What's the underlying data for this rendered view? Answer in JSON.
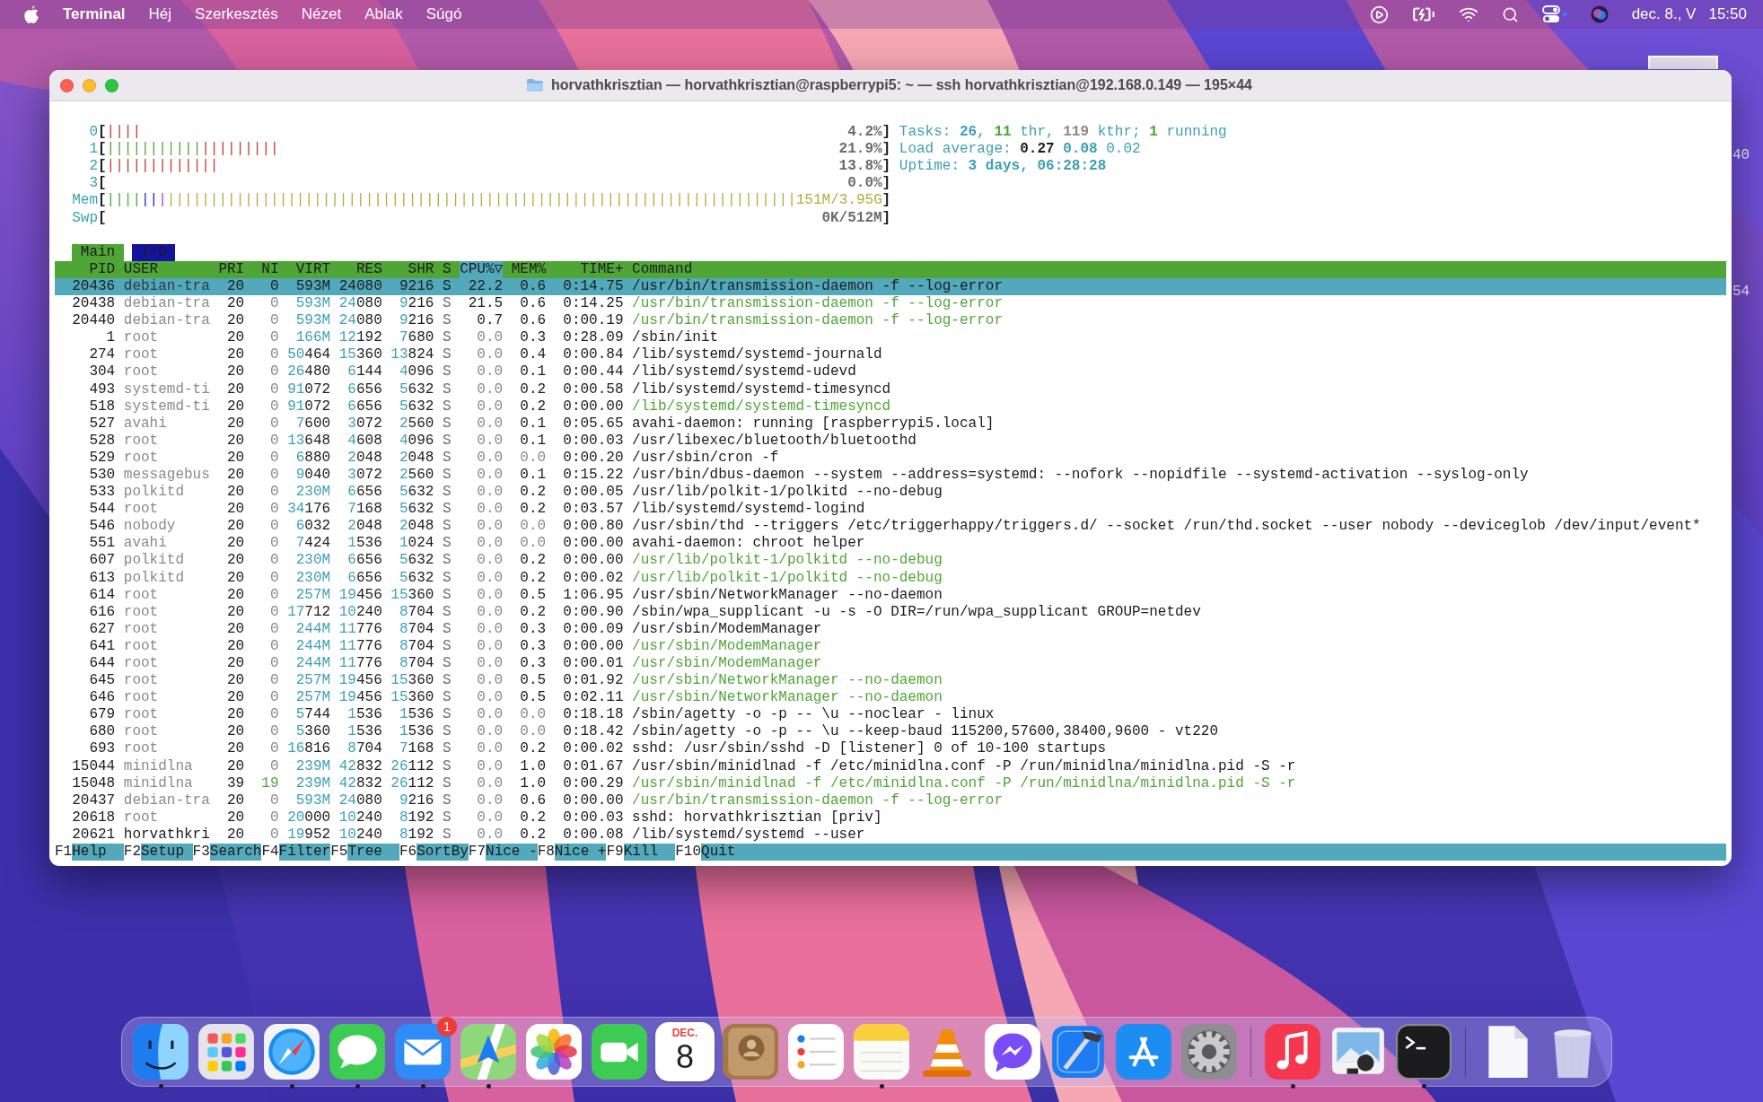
{
  "menu_bar": {
    "app_name": "Terminal",
    "menus": [
      "Héj",
      "Szerkesztés",
      "Nézet",
      "Ablak",
      "Súgó"
    ],
    "date": "dec. 8., V",
    "time": "15:50"
  },
  "window": {
    "title": "horvathkrisztian — horvathkrisztian@raspberrypi5: ~ — ssh horvathkrisztian@192.168.0.149 — 195×44"
  },
  "background_window": {
    "texts": [
      "40",
      "54"
    ]
  },
  "htop": {
    "brackets": [
      "[",
      "]"
    ],
    "meters": [
      {
        "label": "0",
        "segments": [
          {
            "text": "||||",
            "kind": "kernel"
          }
        ],
        "value": "4.2%"
      },
      {
        "label": "1",
        "segments": [
          {
            "text": "|||||||||||",
            "kind": "normal"
          },
          {
            "text": "|||||||||",
            "kind": "kernel"
          }
        ],
        "value": "21.9%"
      },
      {
        "label": "2",
        "segments": [
          {
            "text": "|||||||||||||",
            "kind": "kernel"
          }
        ],
        "value": "13.8%"
      },
      {
        "label": "3",
        "value": "0.0%"
      },
      {
        "label": "Mem",
        "segments": [
          {
            "text": "||||",
            "kind": "normal"
          },
          {
            "text": "||",
            "kind": "buffers"
          },
          {
            "text": "|",
            "kind": "shared"
          },
          {
            "text": "|||||||||||||||||||||||||||||||||||||||||||||||||||||||||||||||||||||||||",
            "kind": "cache"
          }
        ],
        "value": "151M/3.95G",
        "value_in_bar": true
      },
      {
        "label": "Swp",
        "value": "0K/512M"
      }
    ],
    "readouts": [
      [
        {
          "text": "Tasks: ",
          "kind": "label"
        },
        {
          "text": "26",
          "kind": "value"
        },
        {
          "text": ", ",
          "kind": "label"
        },
        {
          "text": "11",
          "kind": "thread"
        },
        {
          "text": " thr, ",
          "kind": "label"
        },
        {
          "text": "119",
          "kind": "kthread"
        },
        {
          "text": " kthr; ",
          "kind": "label"
        },
        {
          "text": "1",
          "kind": "running"
        },
        {
          "text": " running",
          "kind": "label"
        }
      ],
      [
        {
          "text": "Load average: ",
          "kind": "label"
        },
        {
          "text": "0.27 ",
          "kind": "load1"
        },
        {
          "text": "0.08 ",
          "kind": "load5"
        },
        {
          "text": "0.02",
          "kind": "load15"
        }
      ],
      [
        {
          "text": "Uptime: ",
          "kind": "label"
        },
        {
          "text": "3 days, 06:28:28",
          "kind": "value"
        }
      ]
    ],
    "tabs": [
      {
        "label": "Main",
        "selected": true
      },
      {
        "label": "I/O",
        "selected": false
      }
    ],
    "columns": [
      {
        "label": "PID",
        "sorted": false
      },
      {
        "label": "USER",
        "sorted": false
      },
      {
        "label": "PRI",
        "sorted": false
      },
      {
        "label": "NI",
        "sorted": false
      },
      {
        "label": "VIRT",
        "sorted": false
      },
      {
        "label": "RES",
        "sorted": false
      },
      {
        "label": "SHR",
        "sorted": false
      },
      {
        "label": "S",
        "sorted": false
      },
      {
        "label": "CPU%▽",
        "sorted": true
      },
      {
        "label": "MEM%",
        "sorted": false
      },
      {
        "label": "TIME+",
        "sorted": false
      },
      {
        "label": "Command",
        "sorted": false
      }
    ],
    "rows": [
      {
        "pid": "20436",
        "user": "debian-tra",
        "user_dimmed": true,
        "pri": "20",
        "ni": "0",
        "virt": "593M",
        "res": "24080",
        "shr": "9216",
        "state": "S",
        "cpu": "22.2",
        "mem": "0.6",
        "time": "0:14.75",
        "command": "/usr/bin/transmission-daemon -f --log-error",
        "thread": false,
        "selected": true
      },
      {
        "pid": "20438",
        "user": "debian-tra",
        "user_dimmed": true,
        "pri": "20",
        "ni": "0",
        "virt": "593M",
        "res": "24080",
        "shr": "9216",
        "state": "S",
        "cpu": "21.5",
        "mem": "0.6",
        "time": "0:14.25",
        "command": "/usr/bin/transmission-daemon -f --log-error",
        "thread": true,
        "selected": false
      },
      {
        "pid": "20440",
        "user": "debian-tra",
        "user_dimmed": true,
        "pri": "20",
        "ni": "0",
        "virt": "593M",
        "res": "24080",
        "shr": "9216",
        "state": "S",
        "cpu": "0.7",
        "mem": "0.6",
        "time": "0:00.19",
        "command": "/usr/bin/transmission-daemon -f --log-error",
        "thread": true,
        "selected": false
      },
      {
        "pid": "1",
        "user": "root",
        "user_dimmed": true,
        "pri": "20",
        "ni": "0",
        "virt": "166M",
        "res": "12192",
        "shr": "7680",
        "state": "S",
        "cpu": "0.0",
        "mem": "0.3",
        "time": "0:28.09",
        "command": "/sbin/init",
        "thread": false,
        "selected": false
      },
      {
        "pid": "274",
        "user": "root",
        "user_dimmed": true,
        "pri": "20",
        "ni": "0",
        "virt": "50464",
        "res": "15360",
        "shr": "13824",
        "state": "S",
        "cpu": "0.0",
        "mem": "0.4",
        "time": "0:00.84",
        "command": "/lib/systemd/systemd-journald",
        "thread": false,
        "selected": false
      },
      {
        "pid": "304",
        "user": "root",
        "user_dimmed": true,
        "pri": "20",
        "ni": "0",
        "virt": "26480",
        "res": "6144",
        "shr": "4096",
        "state": "S",
        "cpu": "0.0",
        "mem": "0.1",
        "time": "0:00.44",
        "command": "/lib/systemd/systemd-udevd",
        "thread": false,
        "selected": false
      },
      {
        "pid": "493",
        "user": "systemd-ti",
        "user_dimmed": true,
        "pri": "20",
        "ni": "0",
        "virt": "91072",
        "res": "6656",
        "shr": "5632",
        "state": "S",
        "cpu": "0.0",
        "mem": "0.2",
        "time": "0:00.58",
        "command": "/lib/systemd/systemd-timesyncd",
        "thread": false,
        "selected": false
      },
      {
        "pid": "518",
        "user": "systemd-ti",
        "user_dimmed": true,
        "pri": "20",
        "ni": "0",
        "virt": "91072",
        "res": "6656",
        "shr": "5632",
        "state": "S",
        "cpu": "0.0",
        "mem": "0.2",
        "time": "0:00.00",
        "command": "/lib/systemd/systemd-timesyncd",
        "thread": true,
        "selected": false
      },
      {
        "pid": "527",
        "user": "avahi",
        "user_dimmed": true,
        "pri": "20",
        "ni": "0",
        "virt": "7600",
        "res": "3072",
        "shr": "2560",
        "state": "S",
        "cpu": "0.0",
        "mem": "0.1",
        "time": "0:05.65",
        "command": "avahi-daemon: running [raspberrypi5.local]",
        "thread": false,
        "selected": false
      },
      {
        "pid": "528",
        "user": "root",
        "user_dimmed": true,
        "pri": "20",
        "ni": "0",
        "virt": "13648",
        "res": "4608",
        "shr": "4096",
        "state": "S",
        "cpu": "0.0",
        "mem": "0.1",
        "time": "0:00.03",
        "command": "/usr/libexec/bluetooth/bluetoothd",
        "thread": false,
        "selected": false
      },
      {
        "pid": "529",
        "user": "root",
        "user_dimmed": true,
        "pri": "20",
        "ni": "0",
        "virt": "6880",
        "res": "2048",
        "shr": "2048",
        "state": "S",
        "cpu": "0.0",
        "mem": "0.0",
        "time": "0:00.20",
        "command": "/usr/sbin/cron -f",
        "thread": false,
        "selected": false
      },
      {
        "pid": "530",
        "user": "messagebus",
        "user_dimmed": true,
        "pri": "20",
        "ni": "0",
        "virt": "9040",
        "res": "3072",
        "shr": "2560",
        "state": "S",
        "cpu": "0.0",
        "mem": "0.1",
        "time": "0:15.22",
        "command": "/usr/bin/dbus-daemon --system --address=systemd: --nofork --nopidfile --systemd-activation --syslog-only",
        "thread": false,
        "selected": false
      },
      {
        "pid": "533",
        "user": "polkitd",
        "user_dimmed": true,
        "pri": "20",
        "ni": "0",
        "virt": "230M",
        "res": "6656",
        "shr": "5632",
        "state": "S",
        "cpu": "0.0",
        "mem": "0.2",
        "time": "0:00.05",
        "command": "/usr/lib/polkit-1/polkitd --no-debug",
        "thread": false,
        "selected": false
      },
      {
        "pid": "544",
        "user": "root",
        "user_dimmed": true,
        "pri": "20",
        "ni": "0",
        "virt": "34176",
        "res": "7168",
        "shr": "5632",
        "state": "S",
        "cpu": "0.0",
        "mem": "0.2",
        "time": "0:03.57",
        "command": "/lib/systemd/systemd-logind",
        "thread": false,
        "selected": false
      },
      {
        "pid": "546",
        "user": "nobody",
        "user_dimmed": true,
        "pri": "20",
        "ni": "0",
        "virt": "6032",
        "res": "2048",
        "shr": "2048",
        "state": "S",
        "cpu": "0.0",
        "mem": "0.0",
        "time": "0:00.80",
        "command": "/usr/sbin/thd --triggers /etc/triggerhappy/triggers.d/ --socket /run/thd.socket --user nobody --deviceglob /dev/input/event*",
        "thread": false,
        "selected": false
      },
      {
        "pid": "551",
        "user": "avahi",
        "user_dimmed": true,
        "pri": "20",
        "ni": "0",
        "virt": "7424",
        "res": "1536",
        "shr": "1024",
        "state": "S",
        "cpu": "0.0",
        "mem": "0.0",
        "time": "0:00.00",
        "command": "avahi-daemon: chroot helper",
        "thread": false,
        "selected": false
      },
      {
        "pid": "607",
        "user": "polkitd",
        "user_dimmed": true,
        "pri": "20",
        "ni": "0",
        "virt": "230M",
        "res": "6656",
        "shr": "5632",
        "state": "S",
        "cpu": "0.0",
        "mem": "0.2",
        "time": "0:00.00",
        "command": "/usr/lib/polkit-1/polkitd --no-debug",
        "thread": true,
        "selected": false
      },
      {
        "pid": "613",
        "user": "polkitd",
        "user_dimmed": true,
        "pri": "20",
        "ni": "0",
        "virt": "230M",
        "res": "6656",
        "shr": "5632",
        "state": "S",
        "cpu": "0.0",
        "mem": "0.2",
        "time": "0:00.02",
        "command": "/usr/lib/polkit-1/polkitd --no-debug",
        "thread": true,
        "selected": false
      },
      {
        "pid": "614",
        "user": "root",
        "user_dimmed": true,
        "pri": "20",
        "ni": "0",
        "virt": "257M",
        "res": "19456",
        "shr": "15360",
        "state": "S",
        "cpu": "0.0",
        "mem": "0.5",
        "time": "1:06.95",
        "command": "/usr/sbin/NetworkManager --no-daemon",
        "thread": false,
        "selected": false
      },
      {
        "pid": "616",
        "user": "root",
        "user_dimmed": true,
        "pri": "20",
        "ni": "0",
        "virt": "17712",
        "res": "10240",
        "shr": "8704",
        "state": "S",
        "cpu": "0.0",
        "mem": "0.2",
        "time": "0:00.90",
        "command": "/sbin/wpa_supplicant -u -s -O DIR=/run/wpa_supplicant GROUP=netdev",
        "thread": false,
        "selected": false
      },
      {
        "pid": "627",
        "user": "root",
        "user_dimmed": true,
        "pri": "20",
        "ni": "0",
        "virt": "244M",
        "res": "11776",
        "shr": "8704",
        "state": "S",
        "cpu": "0.0",
        "mem": "0.3",
        "time": "0:00.09",
        "command": "/usr/sbin/ModemManager",
        "thread": false,
        "selected": false
      },
      {
        "pid": "641",
        "user": "root",
        "user_dimmed": true,
        "pri": "20",
        "ni": "0",
        "virt": "244M",
        "res": "11776",
        "shr": "8704",
        "state": "S",
        "cpu": "0.0",
        "mem": "0.3",
        "time": "0:00.00",
        "command": "/usr/sbin/ModemManager",
        "thread": true,
        "selected": false
      },
      {
        "pid": "644",
        "user": "root",
        "user_dimmed": true,
        "pri": "20",
        "ni": "0",
        "virt": "244M",
        "res": "11776",
        "shr": "8704",
        "state": "S",
        "cpu": "0.0",
        "mem": "0.3",
        "time": "0:00.01",
        "command": "/usr/sbin/ModemManager",
        "thread": true,
        "selected": false
      },
      {
        "pid": "645",
        "user": "root",
        "user_dimmed": true,
        "pri": "20",
        "ni": "0",
        "virt": "257M",
        "res": "19456",
        "shr": "15360",
        "state": "S",
        "cpu": "0.0",
        "mem": "0.5",
        "time": "0:01.92",
        "command": "/usr/sbin/NetworkManager --no-daemon",
        "thread": true,
        "selected": false
      },
      {
        "pid": "646",
        "user": "root",
        "user_dimmed": true,
        "pri": "20",
        "ni": "0",
        "virt": "257M",
        "res": "19456",
        "shr": "15360",
        "state": "S",
        "cpu": "0.0",
        "mem": "0.5",
        "time": "0:02.11",
        "command": "/usr/sbin/NetworkManager --no-daemon",
        "thread": true,
        "selected": false
      },
      {
        "pid": "679",
        "user": "root",
        "user_dimmed": true,
        "pri": "20",
        "ni": "0",
        "virt": "5744",
        "res": "1536",
        "shr": "1536",
        "state": "S",
        "cpu": "0.0",
        "mem": "0.0",
        "time": "0:18.18",
        "command": "/sbin/agetty -o -p -- \\u --noclear - linux",
        "thread": false,
        "selected": false
      },
      {
        "pid": "680",
        "user": "root",
        "user_dimmed": true,
        "pri": "20",
        "ni": "0",
        "virt": "5360",
        "res": "1536",
        "shr": "1536",
        "state": "S",
        "cpu": "0.0",
        "mem": "0.0",
        "time": "0:18.42",
        "command": "/sbin/agetty -o -p -- \\u --keep-baud 115200,57600,38400,9600 - vt220",
        "thread": false,
        "selected": false
      },
      {
        "pid": "693",
        "user": "root",
        "user_dimmed": true,
        "pri": "20",
        "ni": "0",
        "virt": "16816",
        "res": "8704",
        "shr": "7168",
        "state": "S",
        "cpu": "0.0",
        "mem": "0.2",
        "time": "0:00.02",
        "command": "sshd: /usr/sbin/sshd -D [listener] 0 of 10-100 startups",
        "thread": false,
        "selected": false
      },
      {
        "pid": "15044",
        "user": "minidlna",
        "user_dimmed": true,
        "pri": "20",
        "ni": "0",
        "virt": "239M",
        "res": "42832",
        "shr": "26112",
        "state": "S",
        "cpu": "0.0",
        "mem": "1.0",
        "time": "0:01.67",
        "command": "/usr/sbin/minidlnad -f /etc/minidlna.conf -P /run/minidlna/minidlna.pid -S -r",
        "thread": false,
        "selected": false
      },
      {
        "pid": "15048",
        "user": "minidlna",
        "user_dimmed": true,
        "pri": "39",
        "ni": "19",
        "virt": "239M",
        "res": "42832",
        "shr": "26112",
        "state": "S",
        "cpu": "0.0",
        "mem": "1.0",
        "time": "0:00.29",
        "command": "/usr/sbin/minidlnad -f /etc/minidlna.conf -P /run/minidlna/minidlna.pid -S -r",
        "thread": true,
        "selected": false
      },
      {
        "pid": "20437",
        "user": "debian-tra",
        "user_dimmed": true,
        "pri": "20",
        "ni": "0",
        "virt": "593M",
        "res": "24080",
        "shr": "9216",
        "state": "S",
        "cpu": "0.0",
        "mem": "0.6",
        "time": "0:00.00",
        "command": "/usr/bin/transmission-daemon -f --log-error",
        "thread": true,
        "selected": false
      },
      {
        "pid": "20618",
        "user": "root",
        "user_dimmed": true,
        "pri": "20",
        "ni": "0",
        "virt": "20000",
        "res": "10240",
        "shr": "8192",
        "state": "S",
        "cpu": "0.0",
        "mem": "0.2",
        "time": "0:00.03",
        "command": "sshd: horvathkrisztian [priv]",
        "thread": false,
        "selected": false
      },
      {
        "pid": "20621",
        "user": "horvathkri",
        "user_dimmed": false,
        "pri": "20",
        "ni": "0",
        "virt": "19952",
        "res": "10240",
        "shr": "8192",
        "state": "S",
        "cpu": "0.0",
        "mem": "0.2",
        "time": "0:00.08",
        "command": "/lib/systemd/systemd --user",
        "thread": false,
        "selected": false
      }
    ],
    "function_keys": [
      {
        "key": "F1",
        "label": "Help"
      },
      {
        "key": "F2",
        "label": "Setup"
      },
      {
        "key": "F3",
        "label": "Search"
      },
      {
        "key": "F4",
        "label": "Filter"
      },
      {
        "key": "F5",
        "label": "Tree"
      },
      {
        "key": "F6",
        "label": "SortBy"
      },
      {
        "key": "F7",
        "label": "Nice -"
      },
      {
        "key": "F8",
        "label": "Nice +"
      },
      {
        "key": "F9",
        "label": "Kill"
      },
      {
        "key": "F10",
        "label": "Quit"
      }
    ]
  },
  "dock": {
    "sections": [
      {
        "items": [
          {
            "kind": "finder",
            "running": true
          },
          {
            "kind": "launchpad",
            "running": false
          },
          {
            "kind": "safari",
            "running": true
          },
          {
            "kind": "messages",
            "running": true
          },
          {
            "kind": "mail",
            "running": true,
            "badge": "1"
          },
          {
            "kind": "maps",
            "running": true
          },
          {
            "kind": "photos",
            "running": false
          },
          {
            "kind": "facetime",
            "running": false
          },
          {
            "kind": "calendar",
            "running": false,
            "month": "DEC.",
            "day": "8"
          },
          {
            "kind": "contacts",
            "running": false
          },
          {
            "kind": "reminders",
            "running": false
          },
          {
            "kind": "notes",
            "running": true
          },
          {
            "kind": "vlc",
            "running": false
          },
          {
            "kind": "messenger",
            "running": false
          },
          {
            "kind": "xcode",
            "running": false
          },
          {
            "kind": "appstore",
            "running": false
          },
          {
            "kind": "settings",
            "running": false
          }
        ]
      },
      {
        "items": [
          {
            "kind": "music",
            "running": true
          },
          {
            "kind": "preview",
            "running": false
          },
          {
            "kind": "terminal",
            "running": true
          }
        ]
      },
      {
        "items": [
          {
            "kind": "document",
            "running": false
          },
          {
            "kind": "trash",
            "running": false
          }
        ]
      }
    ]
  }
}
